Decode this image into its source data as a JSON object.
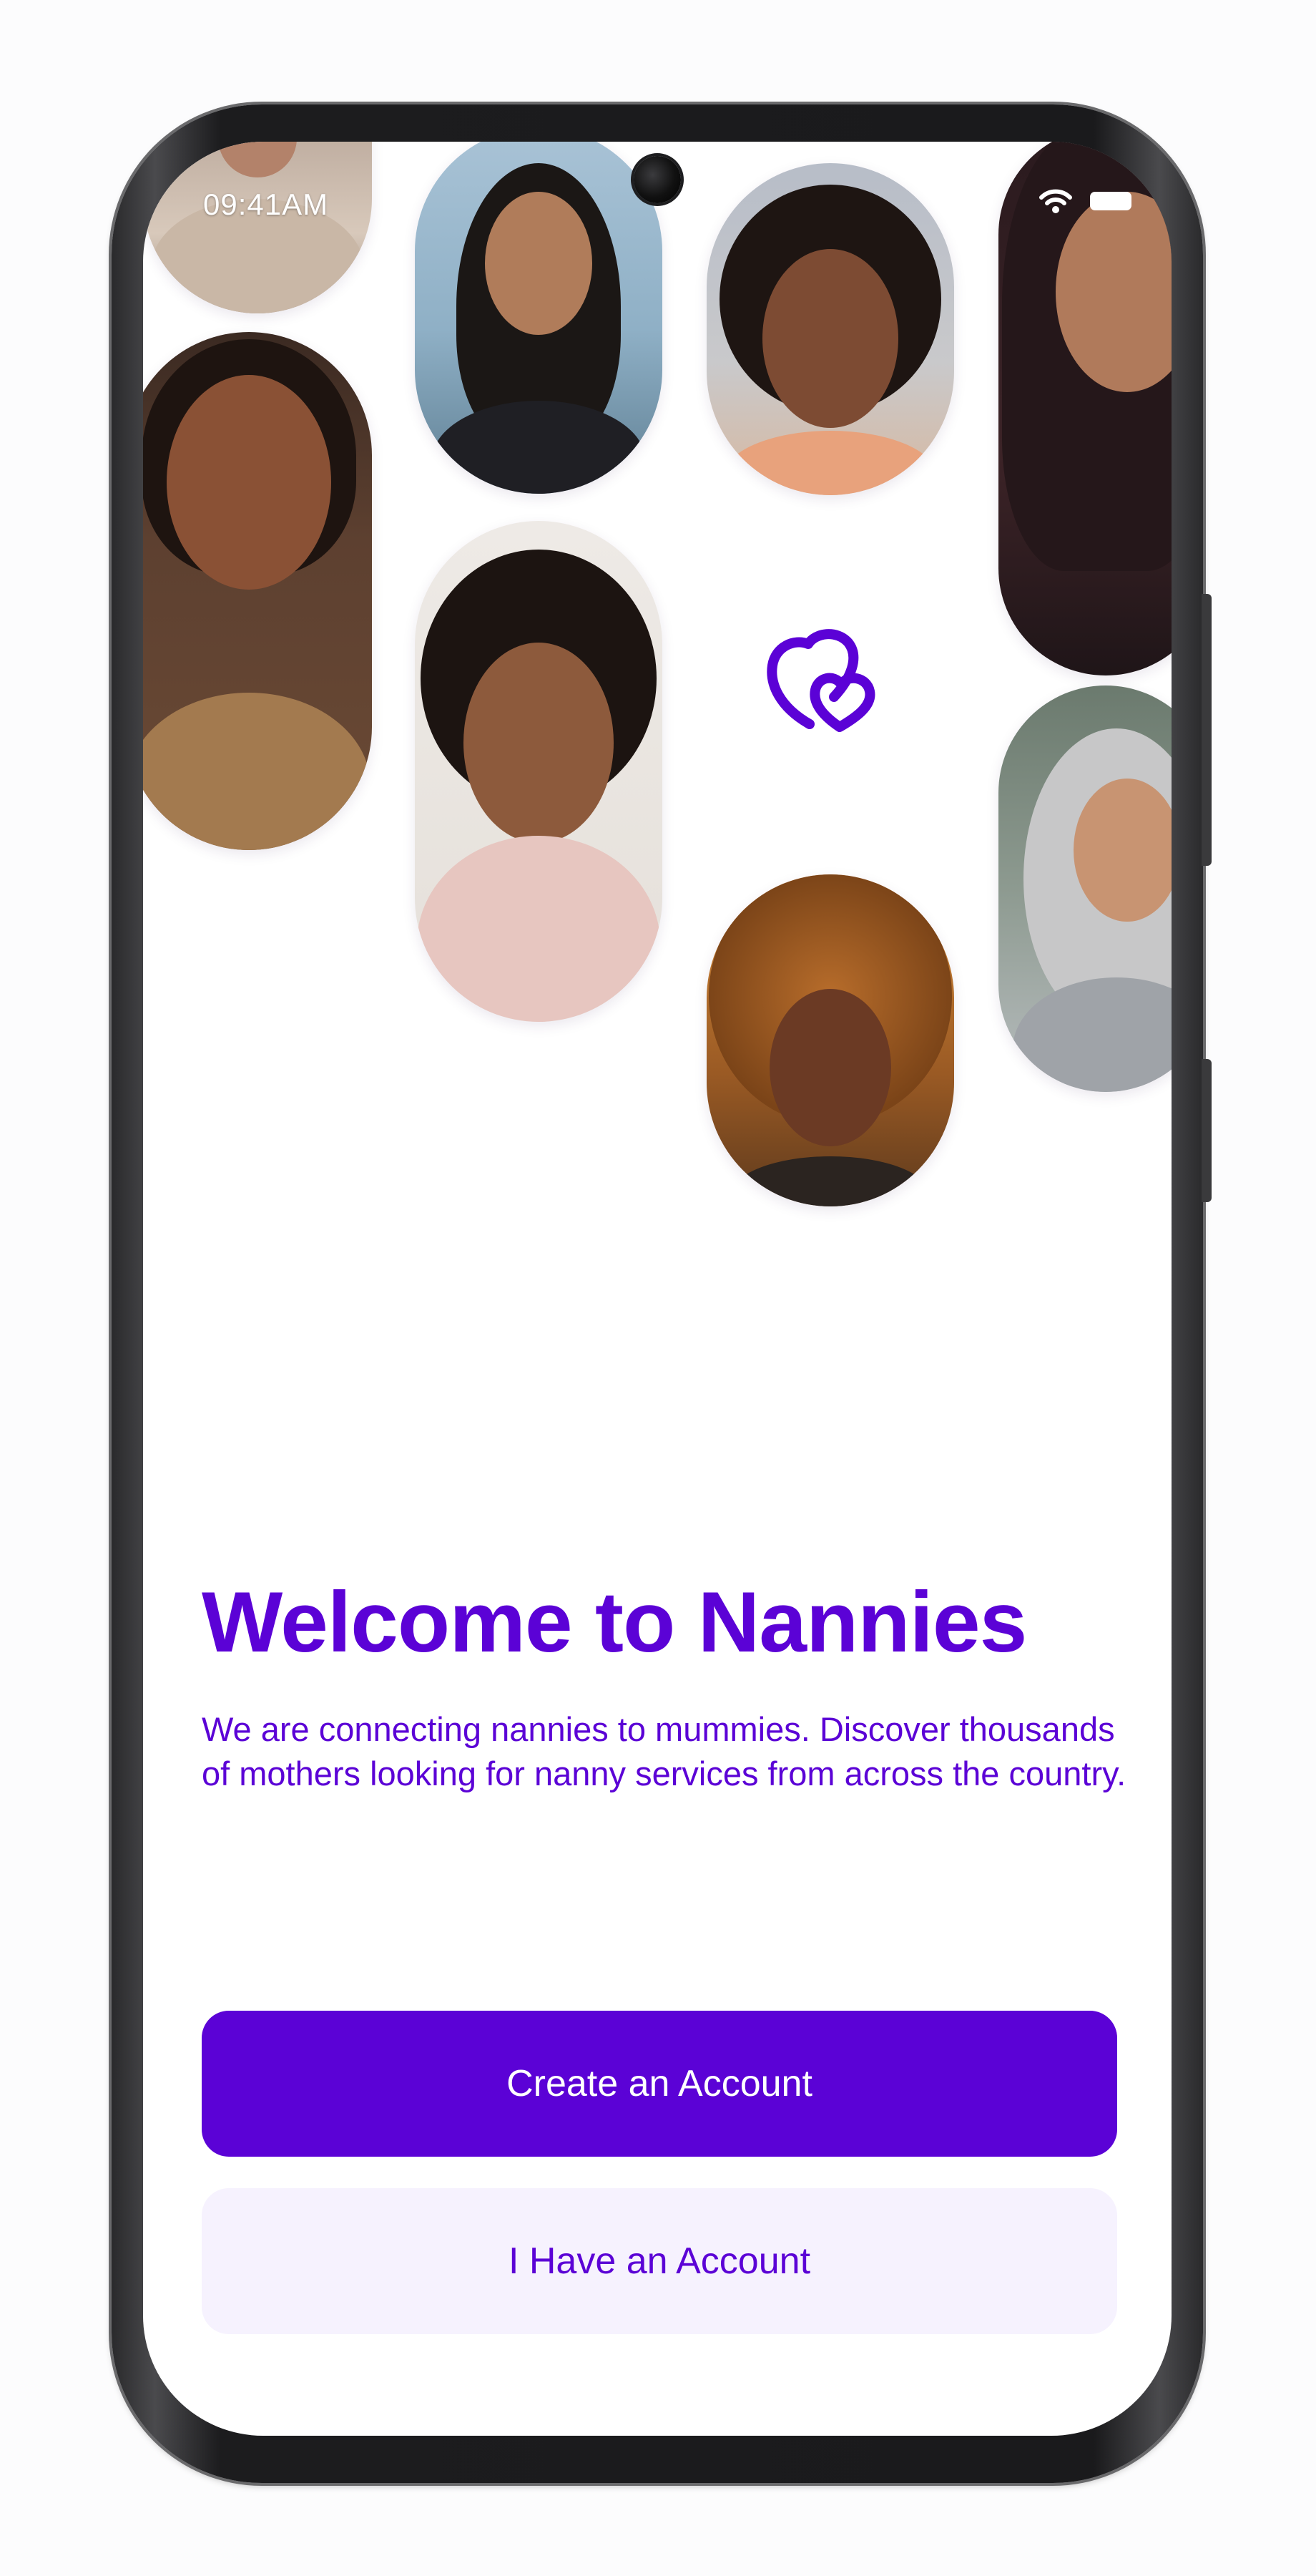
{
  "status_bar": {
    "time": "09:41AM",
    "wifi_icon": "wifi-icon",
    "battery_icon": "battery-icon"
  },
  "brand": {
    "logo_icon": "hearts-logo-icon",
    "accent_color": "#5b02d6",
    "secondary_button_bg": "#f6f2fe"
  },
  "welcome": {
    "title": "Welcome to Nannies",
    "description": "We are connecting nannies to mummies. Discover thousands of mothers looking for nanny services from across the country."
  },
  "actions": {
    "create_account_label": "Create an Account",
    "sign_in_label": "I Have an Account"
  }
}
